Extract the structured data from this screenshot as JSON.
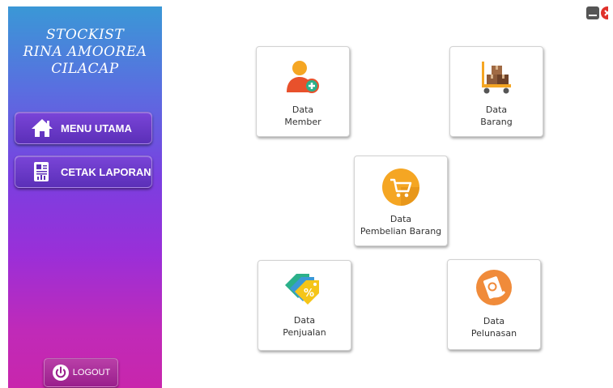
{
  "sidebar": {
    "brand_lines": [
      "STOCKIST",
      "RINA AMOOREA",
      "CILACAP"
    ],
    "menu_utama_label": "MENU UTAMA",
    "menu_utama_icon": "home-icon",
    "cetak_laporan_label": "CETAK LAPORAN",
    "cetak_laporan_icon": "report-icon",
    "logout_label": "LOGOUT",
    "logout_icon": "power-icon"
  },
  "window_controls": {
    "minimize_icon": "minimize-icon",
    "close_icon": "close-icon"
  },
  "cards": {
    "member": {
      "line1": "Data",
      "line2": "Member",
      "icon": "add-member-icon"
    },
    "barang": {
      "line1": "Data",
      "line2": "Barang",
      "icon": "cart-boxes-icon"
    },
    "pembelian": {
      "line1": "Data",
      "line2": "Pembelian Barang",
      "icon": "shopping-cart-icon"
    },
    "penjualan": {
      "line1": "Data",
      "line2": "Penjualan",
      "icon": "price-tags-icon"
    },
    "pelunasan": {
      "line1": "Data",
      "line2": "Pelunasan",
      "icon": "payment-hand-icon"
    }
  },
  "colors": {
    "sidebar_top": "#3a98d6",
    "sidebar_mid": "#7a3fe0",
    "sidebar_bottom": "#c826ac",
    "icon_orange": "#f5a623",
    "close_red": "#e0312b"
  }
}
